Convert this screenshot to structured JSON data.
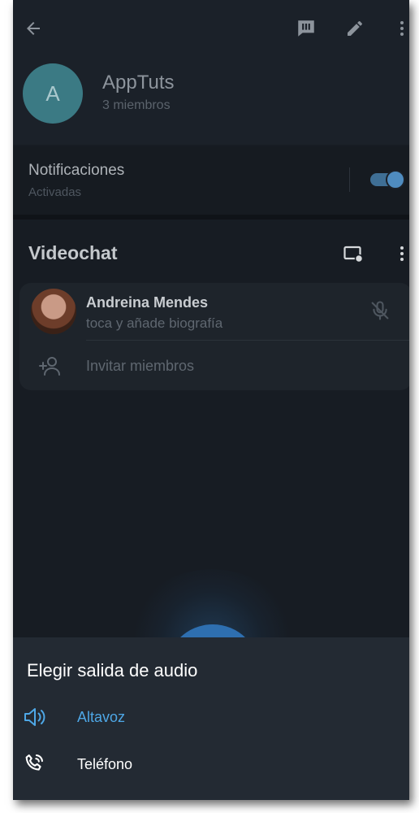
{
  "header": {
    "avatar_letter": "A",
    "group_name": "AppTuts",
    "group_subtitle": "3 miembros"
  },
  "notifications": {
    "title": "Notificaciones",
    "subtitle": "Activadas",
    "enabled": true
  },
  "videochat": {
    "title": "Videochat",
    "member": {
      "name": "Andreina Mendes",
      "bio": "toca y añade biografía",
      "muted": true
    },
    "invite_label": "Invitar miembros"
  },
  "audio_sheet": {
    "title": "Elegir salida de audio",
    "options": [
      {
        "label": "Altavoz",
        "icon": "speaker-icon",
        "selected": true
      },
      {
        "label": "Teléfono",
        "icon": "phone-icon",
        "selected": false
      }
    ]
  },
  "colors": {
    "accent": "#4ea7e6",
    "sheet_background": "#232a33",
    "screen_background": "#171c23"
  }
}
